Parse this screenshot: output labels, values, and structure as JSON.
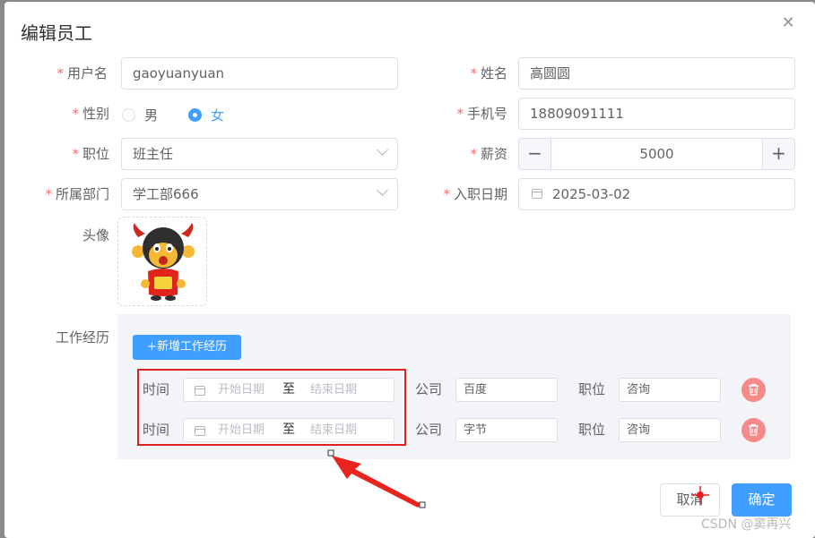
{
  "dialog": {
    "title": "编辑员工",
    "close_icon": "close-icon"
  },
  "form": {
    "username": {
      "label": "用户名",
      "required": true,
      "value": "gaoyuanyuan"
    },
    "name": {
      "label": "姓名",
      "required": true,
      "value": "高圆圆"
    },
    "gender": {
      "label": "性别",
      "required": true,
      "options": [
        "男",
        "女"
      ],
      "selected": "女"
    },
    "phone": {
      "label": "手机号",
      "required": true,
      "value": "18809091111"
    },
    "job": {
      "label": "职位",
      "required": true,
      "value": "班主任"
    },
    "salary": {
      "label": "薪资",
      "required": true,
      "value": "5000",
      "minus": "−",
      "plus": "+"
    },
    "dept": {
      "label": "所属部门",
      "required": true,
      "value": "学工部666"
    },
    "entry_date": {
      "label": "入职日期",
      "required": true,
      "value": "2025-03-02"
    },
    "avatar": {
      "label": "头像"
    },
    "work_exp": {
      "label": "工作经历"
    }
  },
  "work_experience": {
    "add_button": "+新增工作经历",
    "rows": [
      {
        "time_label": "时间",
        "start_placeholder": "开始日期",
        "sep": "至",
        "end_placeholder": "结束日期",
        "company_label": "公司",
        "company": "百度",
        "position_label": "职位",
        "position": "咨询"
      },
      {
        "time_label": "时间",
        "start_placeholder": "开始日期",
        "sep": "至",
        "end_placeholder": "结束日期",
        "company_label": "公司",
        "company": "字节",
        "position_label": "职位",
        "position": "咨询"
      }
    ]
  },
  "footer": {
    "cancel": "取消",
    "confirm": "确定"
  },
  "watermark": "CSDN @窦再兴",
  "colors": {
    "primary": "#409eff",
    "required": "#f56c6c",
    "danger": "#f78989",
    "annotation": "#e02020"
  }
}
